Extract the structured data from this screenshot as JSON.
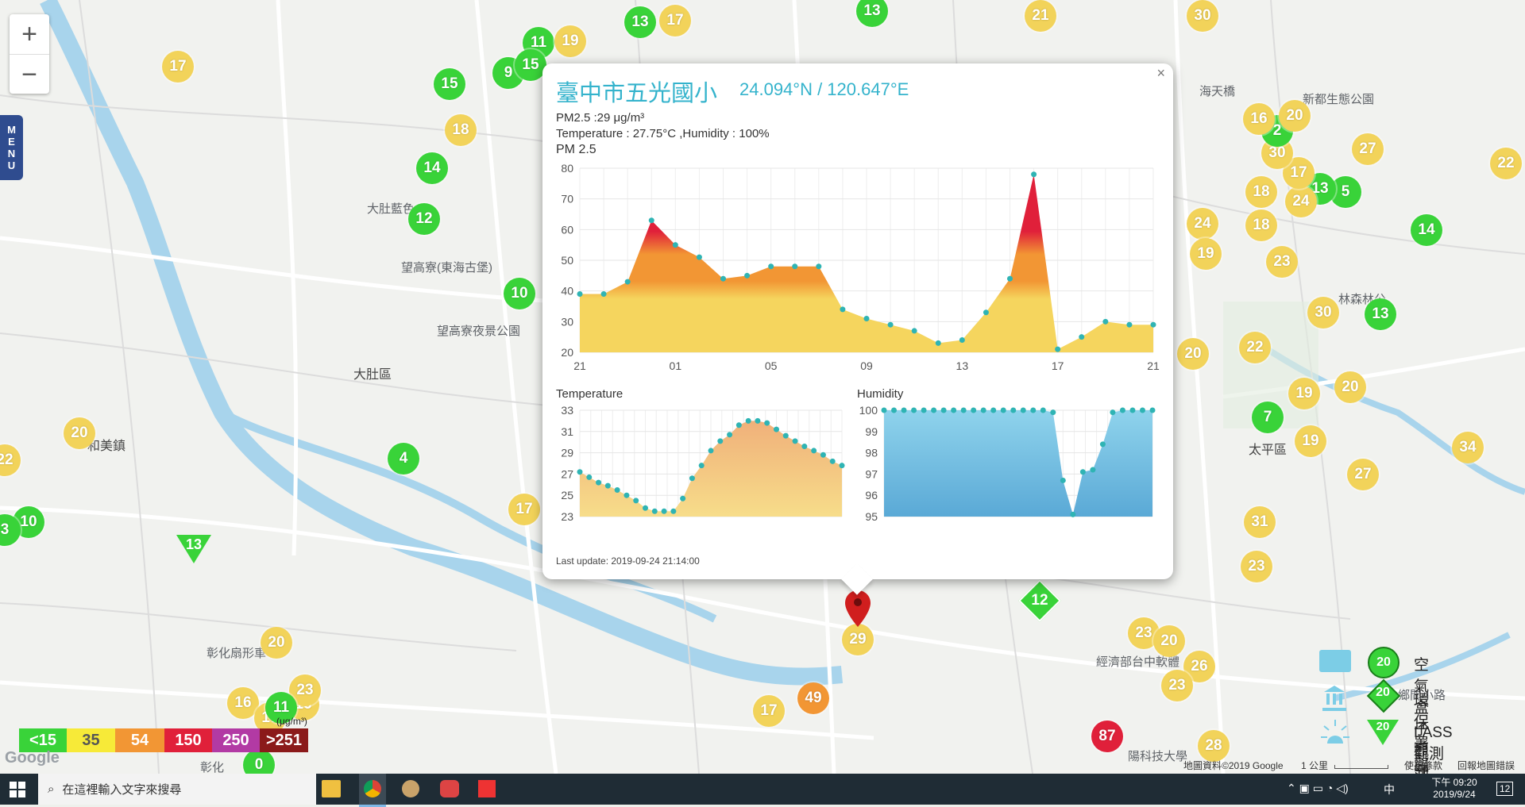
{
  "map": {
    "zoom_in": "+",
    "zoom_out": "−",
    "menu_label": [
      "M",
      "E",
      "N",
      "U"
    ],
    "places": [
      {
        "name": "大肚藍色"
      },
      {
        "name": "望高寮(東海古堡)"
      },
      {
        "name": "望高寮夜景公園"
      },
      {
        "name": "大肚區"
      },
      {
        "name": "和美鎮"
      },
      {
        "name": "彰化扇形車"
      },
      {
        "name": "太平區"
      },
      {
        "name": "新都生態公園"
      },
      {
        "name": "海天橋"
      },
      {
        "name": "林森林公"
      },
      {
        "name": "鄉間小路"
      },
      {
        "name": "經濟部台中軟體"
      },
      {
        "name": "陽科技大學"
      },
      {
        "name": "彰化"
      }
    ],
    "circle_markers": [
      {
        "v": "17",
        "c": "yellow"
      },
      {
        "v": "13",
        "c": "green"
      },
      {
        "v": "21",
        "c": "yellow"
      },
      {
        "v": "30",
        "c": "yellow"
      },
      {
        "v": "11",
        "c": "green"
      },
      {
        "v": "19",
        "c": "yellow"
      },
      {
        "v": "13",
        "c": "green"
      },
      {
        "v": "17",
        "c": "yellow"
      },
      {
        "v": "9",
        "c": "green"
      },
      {
        "v": "15",
        "c": "green"
      },
      {
        "v": "15",
        "c": "green"
      },
      {
        "v": "18",
        "c": "yellow"
      },
      {
        "v": "14",
        "c": "green"
      },
      {
        "v": "12",
        "c": "green"
      },
      {
        "v": "10",
        "c": "green"
      },
      {
        "v": "4",
        "c": "green"
      },
      {
        "v": "20",
        "c": "yellow"
      },
      {
        "v": "10",
        "c": "green"
      },
      {
        "v": "22",
        "c": "yellow"
      },
      {
        "v": "3",
        "c": "green"
      },
      {
        "v": "17",
        "c": "yellow"
      },
      {
        "v": "20",
        "c": "yellow"
      },
      {
        "v": "16",
        "c": "yellow"
      },
      {
        "v": "16",
        "c": "yellow"
      },
      {
        "v": "17",
        "c": "yellow"
      },
      {
        "v": "23",
        "c": "yellow"
      },
      {
        "v": "11",
        "c": "green"
      },
      {
        "v": "0",
        "c": "green"
      },
      {
        "v": "17",
        "c": "yellow"
      },
      {
        "v": "49",
        "c": "orange"
      },
      {
        "v": "29",
        "c": "yellow"
      },
      {
        "v": "87",
        "c": "red"
      },
      {
        "v": "23",
        "c": "yellow"
      },
      {
        "v": "20",
        "c": "yellow"
      },
      {
        "v": "26",
        "c": "yellow"
      },
      {
        "v": "23",
        "c": "yellow"
      },
      {
        "v": "28",
        "c": "yellow"
      },
      {
        "v": "23",
        "c": "yellow"
      },
      {
        "v": "31",
        "c": "yellow"
      },
      {
        "v": "27",
        "c": "yellow"
      },
      {
        "v": "19",
        "c": "yellow"
      },
      {
        "v": "7",
        "c": "green"
      },
      {
        "v": "19",
        "c": "yellow"
      },
      {
        "v": "20",
        "c": "yellow"
      },
      {
        "v": "22",
        "c": "yellow"
      },
      {
        "v": "20",
        "c": "yellow"
      },
      {
        "v": "30",
        "c": "yellow"
      },
      {
        "v": "13",
        "c": "green"
      },
      {
        "v": "14",
        "c": "green"
      },
      {
        "v": "34",
        "c": "yellow"
      },
      {
        "v": "22",
        "c": "yellow"
      },
      {
        "v": "27",
        "c": "yellow"
      },
      {
        "v": "5",
        "c": "green"
      },
      {
        "v": "13",
        "c": "green"
      },
      {
        "v": "24",
        "c": "yellow"
      },
      {
        "v": "18",
        "c": "yellow"
      },
      {
        "v": "18",
        "c": "yellow"
      },
      {
        "v": "24",
        "c": "yellow"
      },
      {
        "v": "23",
        "c": "yellow"
      },
      {
        "v": "17",
        "c": "yellow"
      },
      {
        "v": "30",
        "c": "yellow"
      },
      {
        "v": "2",
        "c": "green"
      },
      {
        "v": "20",
        "c": "yellow"
      },
      {
        "v": "16",
        "c": "yellow"
      },
      {
        "v": "19",
        "c": "yellow"
      }
    ],
    "diamond_marker": {
      "v": "12"
    },
    "triangle_marker": {
      "v": "13"
    },
    "colors": {
      "green": "#39d339",
      "yellow": "#f2d35a",
      "orange": "#f29634",
      "red": "#e0203a",
      "popup_accent": "#34b3cc"
    }
  },
  "popup": {
    "title": "臺中市五光國小",
    "coords": "24.094°N / 120.647°E",
    "pm25_line": "PM2.5 :29 μg/m³",
    "weather_line": "Temperature : 27.75°C ,Humidity : 100%",
    "chart_title": "PM 2.5",
    "last_update": "Last update: 2019-09-24 21:14:00",
    "close": "×"
  },
  "chart_data": [
    {
      "type": "area",
      "title": "PM 2.5",
      "xlabel": "",
      "ylabel": "",
      "x_tick_labels": [
        "21",
        "01",
        "05",
        "09",
        "13",
        "17",
        "21"
      ],
      "y_tick_labels": [
        "20",
        "30",
        "40",
        "50",
        "60",
        "70",
        "80"
      ],
      "ylim": [
        20,
        80
      ],
      "series": [
        {
          "values": [
            39,
            39,
            43,
            63,
            55,
            51,
            44,
            45,
            48,
            48,
            48,
            34,
            31,
            29,
            27,
            23,
            24,
            33,
            44,
            78,
            21,
            25,
            30,
            29,
            29
          ]
        }
      ]
    },
    {
      "type": "area",
      "title": "Temperature",
      "y_tick_labels": [
        "23",
        "25",
        "27",
        "29",
        "31",
        "33"
      ],
      "ylim": [
        23,
        33
      ],
      "series": [
        {
          "values": [
            27.2,
            26.7,
            26.2,
            25.9,
            25.5,
            25.0,
            24.5,
            23.8,
            23.5,
            23.5,
            23.5,
            24.7,
            26.6,
            27.8,
            29.2,
            30.1,
            30.7,
            31.6,
            32.0,
            32.0,
            31.8,
            31.2,
            30.6,
            30.1,
            29.6,
            29.2,
            28.8,
            28.2,
            27.8
          ]
        }
      ]
    },
    {
      "type": "area",
      "title": "Humidity",
      "y_tick_labels": [
        "95",
        "96",
        "97",
        "98",
        "99",
        "100"
      ],
      "ylim": [
        95,
        100
      ],
      "series": [
        {
          "values": [
            100,
            100,
            100,
            100,
            100,
            100,
            100,
            100,
            100,
            100,
            100,
            100,
            100,
            100,
            100,
            100,
            100,
            99.9,
            96.7,
            95.1,
            97.1,
            97.2,
            98.4,
            99.9,
            100,
            100,
            100,
            100
          ]
        }
      ]
    }
  ],
  "aqi_scale": [
    {
      "label": "<15",
      "color": "#39d339"
    },
    {
      "label": "35",
      "color": "#f7ea38"
    },
    {
      "label": "54",
      "color": "#f29634"
    },
    {
      "label": "150",
      "color": "#e0203a"
    },
    {
      "label": "250",
      "color": "#b23aa4"
    },
    {
      "label": ">251",
      "color": "#8b1a1a"
    }
  ],
  "aqi_unit": "(μg/m³)",
  "legend": {
    "rows": [
      {
        "label": "空氣盒子觀測點",
        "v": "20"
      },
      {
        "label": "環保署觀測站",
        "v": "20"
      },
      {
        "label": "LASS觀測站",
        "v": "20"
      }
    ]
  },
  "attribution": {
    "data": "地圖資料©2019 Google",
    "scale": "1 公里",
    "terms": "使用條款",
    "report": "回報地圖錯誤",
    "google": "Google"
  },
  "taskbar": {
    "search_placeholder": "在這裡輸入文字來搜尋",
    "time": "下午 09:20",
    "date": "2019/9/24",
    "ime": "中",
    "notif": "12"
  }
}
